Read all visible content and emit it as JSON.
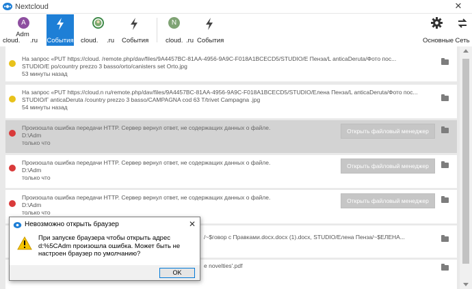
{
  "window": {
    "title": "Nextcloud",
    "close_glyph": "✕"
  },
  "toolbar": {
    "accounts": [
      {
        "avatar_letter": "A",
        "avatar_color": "#8e4fa0",
        "name": "Adm",
        "host": "cloud.",
        "tld": ".ru"
      },
      {
        "avatar_letter": "",
        "avatar_color": "#3f8a4a",
        "host": "cloud.",
        "tld": ".ru"
      },
      {
        "avatar_letter": "N",
        "avatar_color": "#7fa374",
        "host": "cloud.",
        "tld": ".ru"
      }
    ],
    "activity_label": "События",
    "settings_label": "Основные",
    "network_label": "Сеть",
    "accent": "#1e7fd6"
  },
  "activities": [
    {
      "status": "warning",
      "line1": "На запрос «PUT https://cloud.                /remote.php/dav/files/9A4457BC-81AA-4956-9A9C-F018A1BCECD5/STUDIO/Е             Пенза/L anticaDeruta/Фото пос...",
      "line2": "STUDIO/Е                                   po/country prezzo 3 basso/orto/canisters set Orto.jpg",
      "time": "53 минуты назад"
    },
    {
      "status": "warning",
      "line1": "На запрос «PUT https://cloud.n          ru/remote.php/dav/files/9A4457BC-81AA-4956-9A9C-F018A1BCECD5/STUDIO/Елена Пенза/L anticaDeruta/Фото пос...",
      "line2": "STUDIO/Г        anticaDeruta             /country prezzo 3 basso/CAMPAGNA cod 63 T/trivet Campagna .jpg",
      "time": "54 минуты назад"
    },
    {
      "status": "error",
      "line1": "Произошла ошибка передачи HTTP. Сервер вернул ответ, не содержащих данных о файле.",
      "line2": "D:\\Adm",
      "time": "только что",
      "button": "Открыть файловый менеджер",
      "selected": true
    },
    {
      "status": "error",
      "line1": "Произошла ошибка передачи HTTP. Сервер вернул ответ, не содержащих данных о файле.",
      "line2": "D:\\Adm",
      "time": "только что",
      "button": "Открыть файловый менеджер"
    },
    {
      "status": "error",
      "line1": "Произошла ошибка передачи HTTP. Сервер вернул ответ, не содержащих данных о файле.",
      "line2": "D:\\Adm",
      "time": "только что",
      "button": "Открыть файловый менеджер"
    },
    {
      "status": "warning",
      "line1": "/~$говор с Правками.docx.docx (1).docx, STUDIO/Елена Пенза/~$ЕЛЕНА...",
      "line2": "",
      "time": ""
    },
    {
      "status": "warning",
      "line1": "e novelties'.pdf",
      "line2": "",
      "time": ""
    }
  ],
  "status_colors": {
    "warning": "#e8c21b",
    "error": "#d93a3a"
  },
  "dialog": {
    "title": "Невозможно открыть браузер",
    "message": "При запуске браузера чтобы открыть адрес d:%5CAdm произошла ошибка. Может быть не настроен браузер по умолчанию?",
    "ok_label": "OK",
    "icon": "warning-triangle-icon"
  }
}
